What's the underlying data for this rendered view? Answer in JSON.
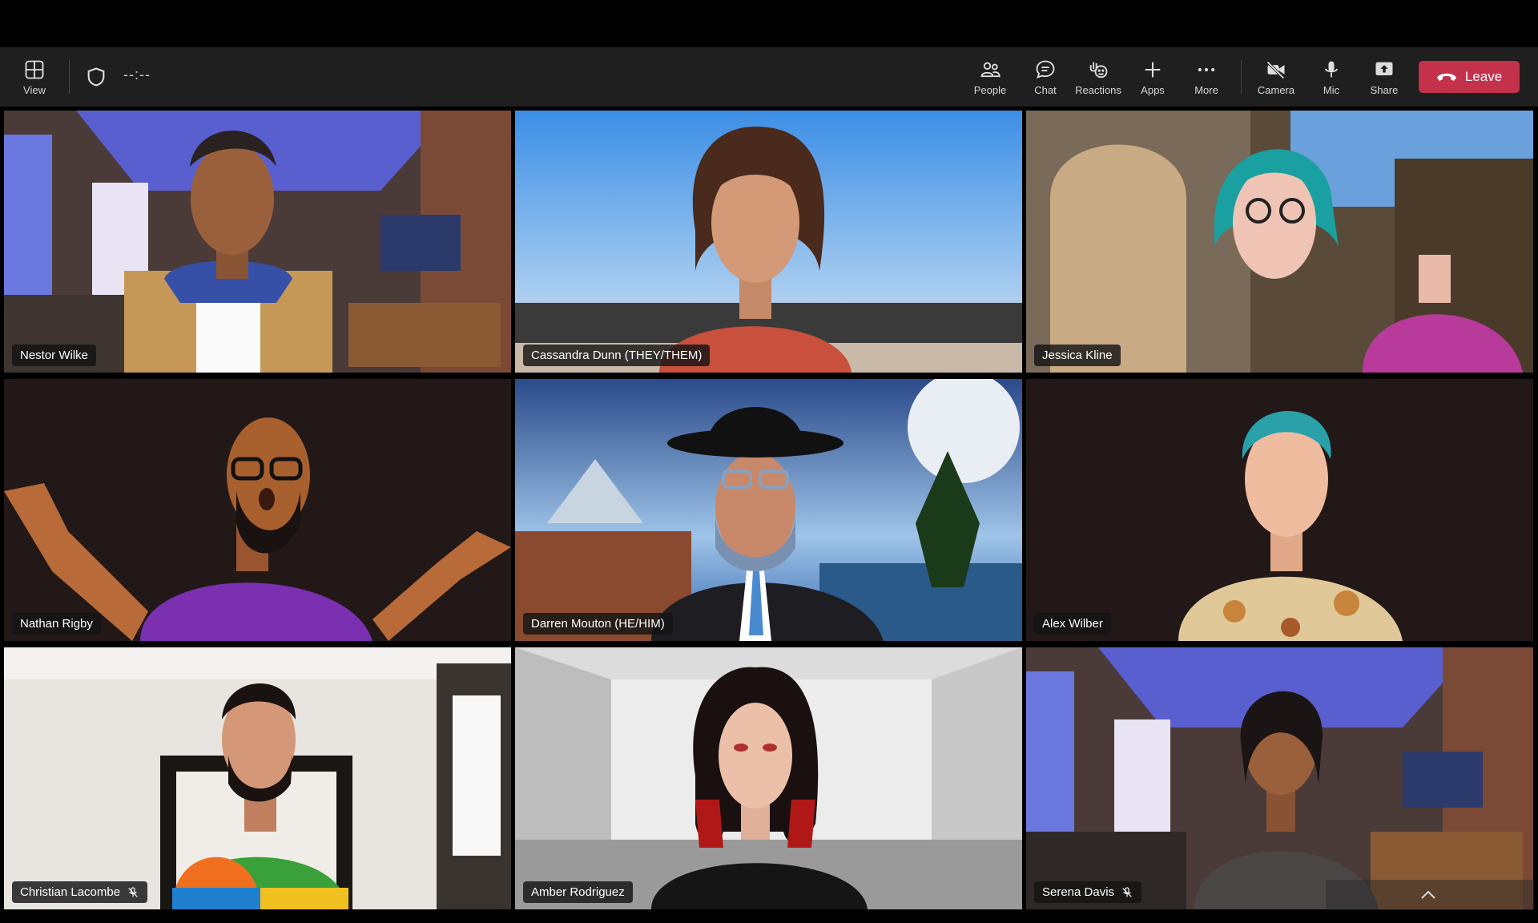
{
  "toolbar": {
    "view_label": "View",
    "timer": "--:--",
    "people_label": "People",
    "chat_label": "Chat",
    "reactions_label": "Reactions",
    "apps_label": "Apps",
    "more_label": "More",
    "camera_label": "Camera",
    "mic_label": "Mic",
    "share_label": "Share",
    "leave_label": "Leave",
    "leave_color": "#c4314b"
  },
  "tiles": [
    {
      "name": "Nestor Wilke",
      "muted": false,
      "background": "living-room"
    },
    {
      "name": "Cassandra Dunn (THEY/THEM)",
      "muted": false,
      "background": "beach"
    },
    {
      "name": "Jessica Kline",
      "muted": false,
      "background": "fantasy-village"
    },
    {
      "name": "Nathan Rigby",
      "muted": false,
      "background": "dark"
    },
    {
      "name": "Darren Mouton (HE/HIM)",
      "muted": false,
      "background": "mountain-lake"
    },
    {
      "name": "Alex Wilber",
      "muted": false,
      "background": "dark",
      "active_speaker": true
    },
    {
      "name": "Christian Lacombe",
      "muted": true,
      "background": "white-room"
    },
    {
      "name": "Amber Rodriguez",
      "muted": false,
      "background": "studio"
    },
    {
      "name": "Serena Davis",
      "muted": true,
      "background": "living-room"
    }
  ],
  "colors": {
    "toolbar_bg": "#1f1f1f",
    "active_border": "#8e8ff0"
  }
}
